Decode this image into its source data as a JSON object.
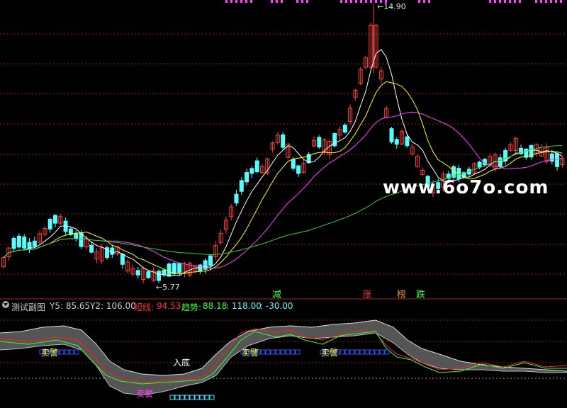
{
  "chart_data": [
    {
      "type": "candlestick",
      "annotations": {
        "high_label": "14.90",
        "low_label": "5.77",
        "signals": [
          "减",
          "涨",
          "榜",
          "跌"
        ]
      },
      "high_value": 14.9,
      "low_value": 5.77
    },
    {
      "type": "line",
      "header": {
        "name": "测试副图",
        "y5": "Y5: 85.65",
        "y2": "Y2: 106.00",
        "short_label": "短线:",
        "short_value": "94.53",
        "trend_label": "趋势:",
        "trend_value": "88.18",
        "v3": ": 118.00",
        "v4": ": -30.00"
      },
      "annotations": [
        "卖警",
        "卖警",
        "卖警",
        "卖警",
        "入底"
      ]
    }
  ],
  "watermark": "www.6o7o.com",
  "colors": {
    "up": "#ff3c3c",
    "down": "#54ffff",
    "grid": "#a01818",
    "ma_white": "#ffffff",
    "ma_yellow": "#ffff00",
    "ma_magenta": "#ff40ff",
    "ma_green": "#30d030",
    "sub_red": "#ff2020",
    "sub_green": "#30ff30",
    "band": "#888888"
  }
}
